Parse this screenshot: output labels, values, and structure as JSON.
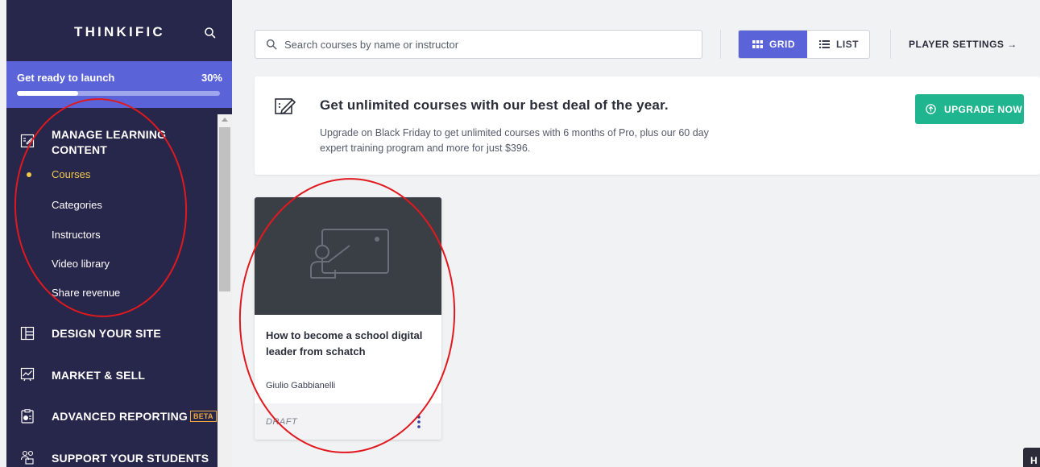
{
  "brand": {
    "name": "THINKIFIC",
    "search_icon": "search-icon"
  },
  "launch": {
    "label": "Get ready to launch",
    "percent_text": "30%",
    "progress": 0.3
  },
  "sidebar": {
    "manage": {
      "label_line1": "MANAGE LEARNING",
      "label_line2": "CONTENT",
      "icon": "manage-content-icon"
    },
    "sub_items": [
      {
        "label": "Courses",
        "active": true
      },
      {
        "label": "Categories"
      },
      {
        "label": "Instructors"
      },
      {
        "label": "Video library"
      },
      {
        "label": "Share revenue"
      }
    ],
    "sections": [
      {
        "label": "DESIGN YOUR SITE",
        "icon": "layout-icon"
      },
      {
        "label": "MARKET & SELL",
        "icon": "chart-icon"
      },
      {
        "label": "ADVANCED REPORTING",
        "badge": "BETA",
        "icon": "report-icon"
      },
      {
        "label": "SUPPORT YOUR STUDENTS",
        "icon": "students-icon"
      }
    ]
  },
  "toolbar": {
    "search_placeholder": "Search courses by name or instructor",
    "grid_label": "GRID",
    "list_label": "LIST",
    "player_settings": "PLAYER SETTINGS →"
  },
  "banner": {
    "title": "Get unlimited courses with our best deal of the year.",
    "body": "Upgrade on Black Friday to get unlimited courses with 6 months of Pro, plus our 60 day expert training program and more for just $396.",
    "button": "UPGRADE NOW"
  },
  "course": {
    "title": "How to become a school digital leader from schatch",
    "author": "Giulio Gabbianelli",
    "status": "DRAFT"
  },
  "help": {
    "label": "H"
  },
  "colors": {
    "sidebar": "#27264b",
    "accent": "#5a63d8",
    "upgrade": "#1fb58f",
    "active": "#f2c94c",
    "annotation": "#e0191f"
  }
}
